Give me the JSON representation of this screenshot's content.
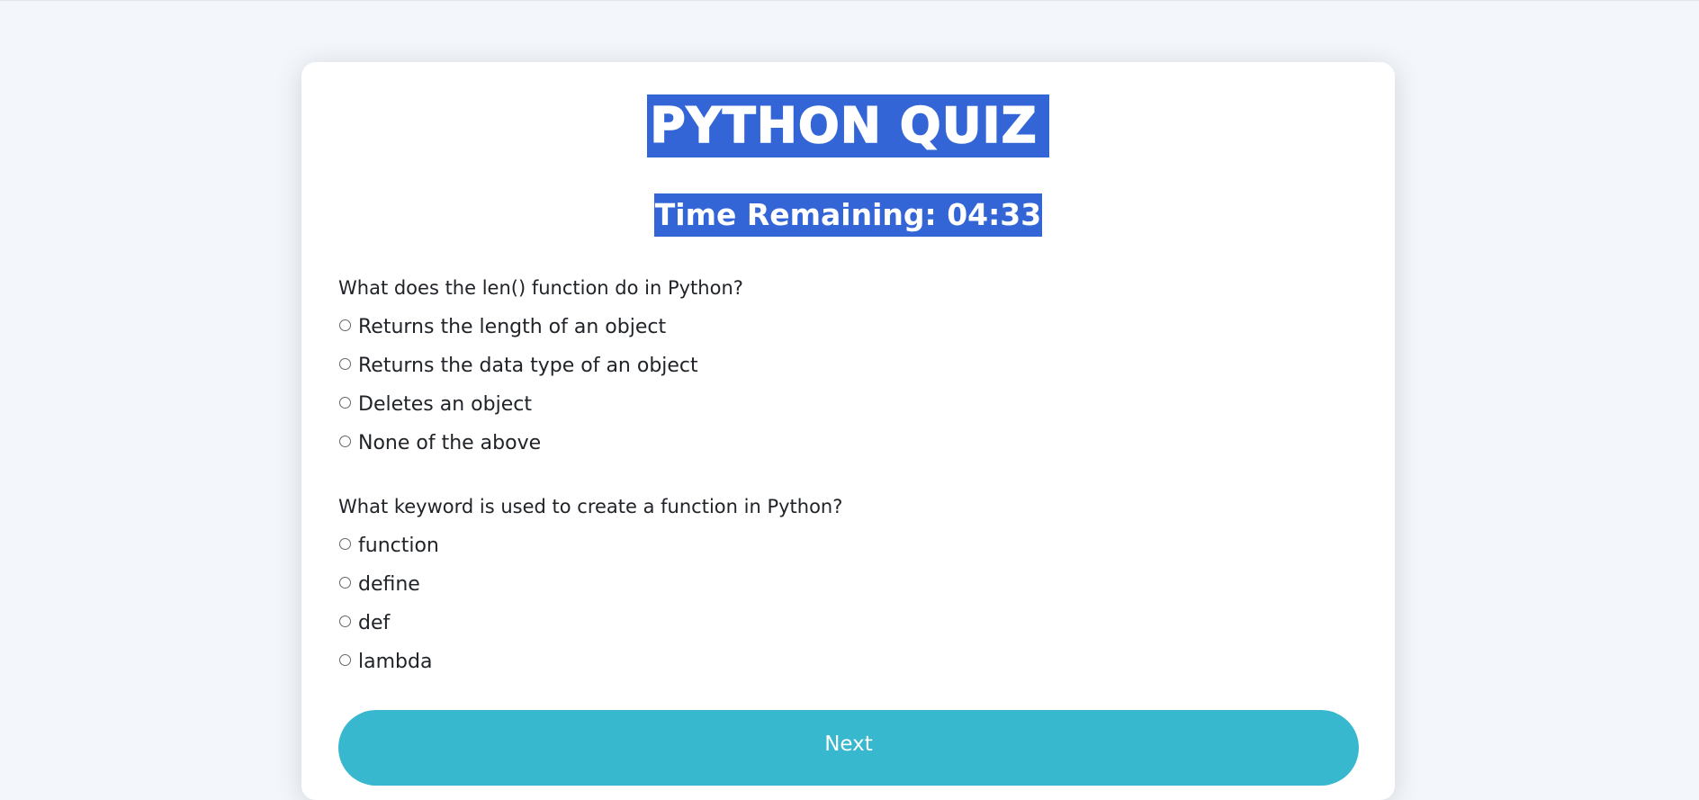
{
  "quiz": {
    "title": "Python Quiz",
    "timer": "Time Remaining: 04:33"
  },
  "questions": [
    {
      "text": "What does the len() function do in Python?",
      "options": [
        "Returns the length of an object",
        "Returns the data type of an object",
        "Deletes an object",
        "None of the above"
      ]
    },
    {
      "text": "What keyword is used to create a function in Python?",
      "options": [
        "function",
        "define",
        "def",
        "lambda"
      ]
    }
  ],
  "actions": {
    "next_label": "Next"
  },
  "colors": {
    "background": "#f3f6fa",
    "highlight": "#3365d6",
    "button": "#38b8cf"
  },
  "icons": {
    "radio": "radio-circle-icon"
  }
}
